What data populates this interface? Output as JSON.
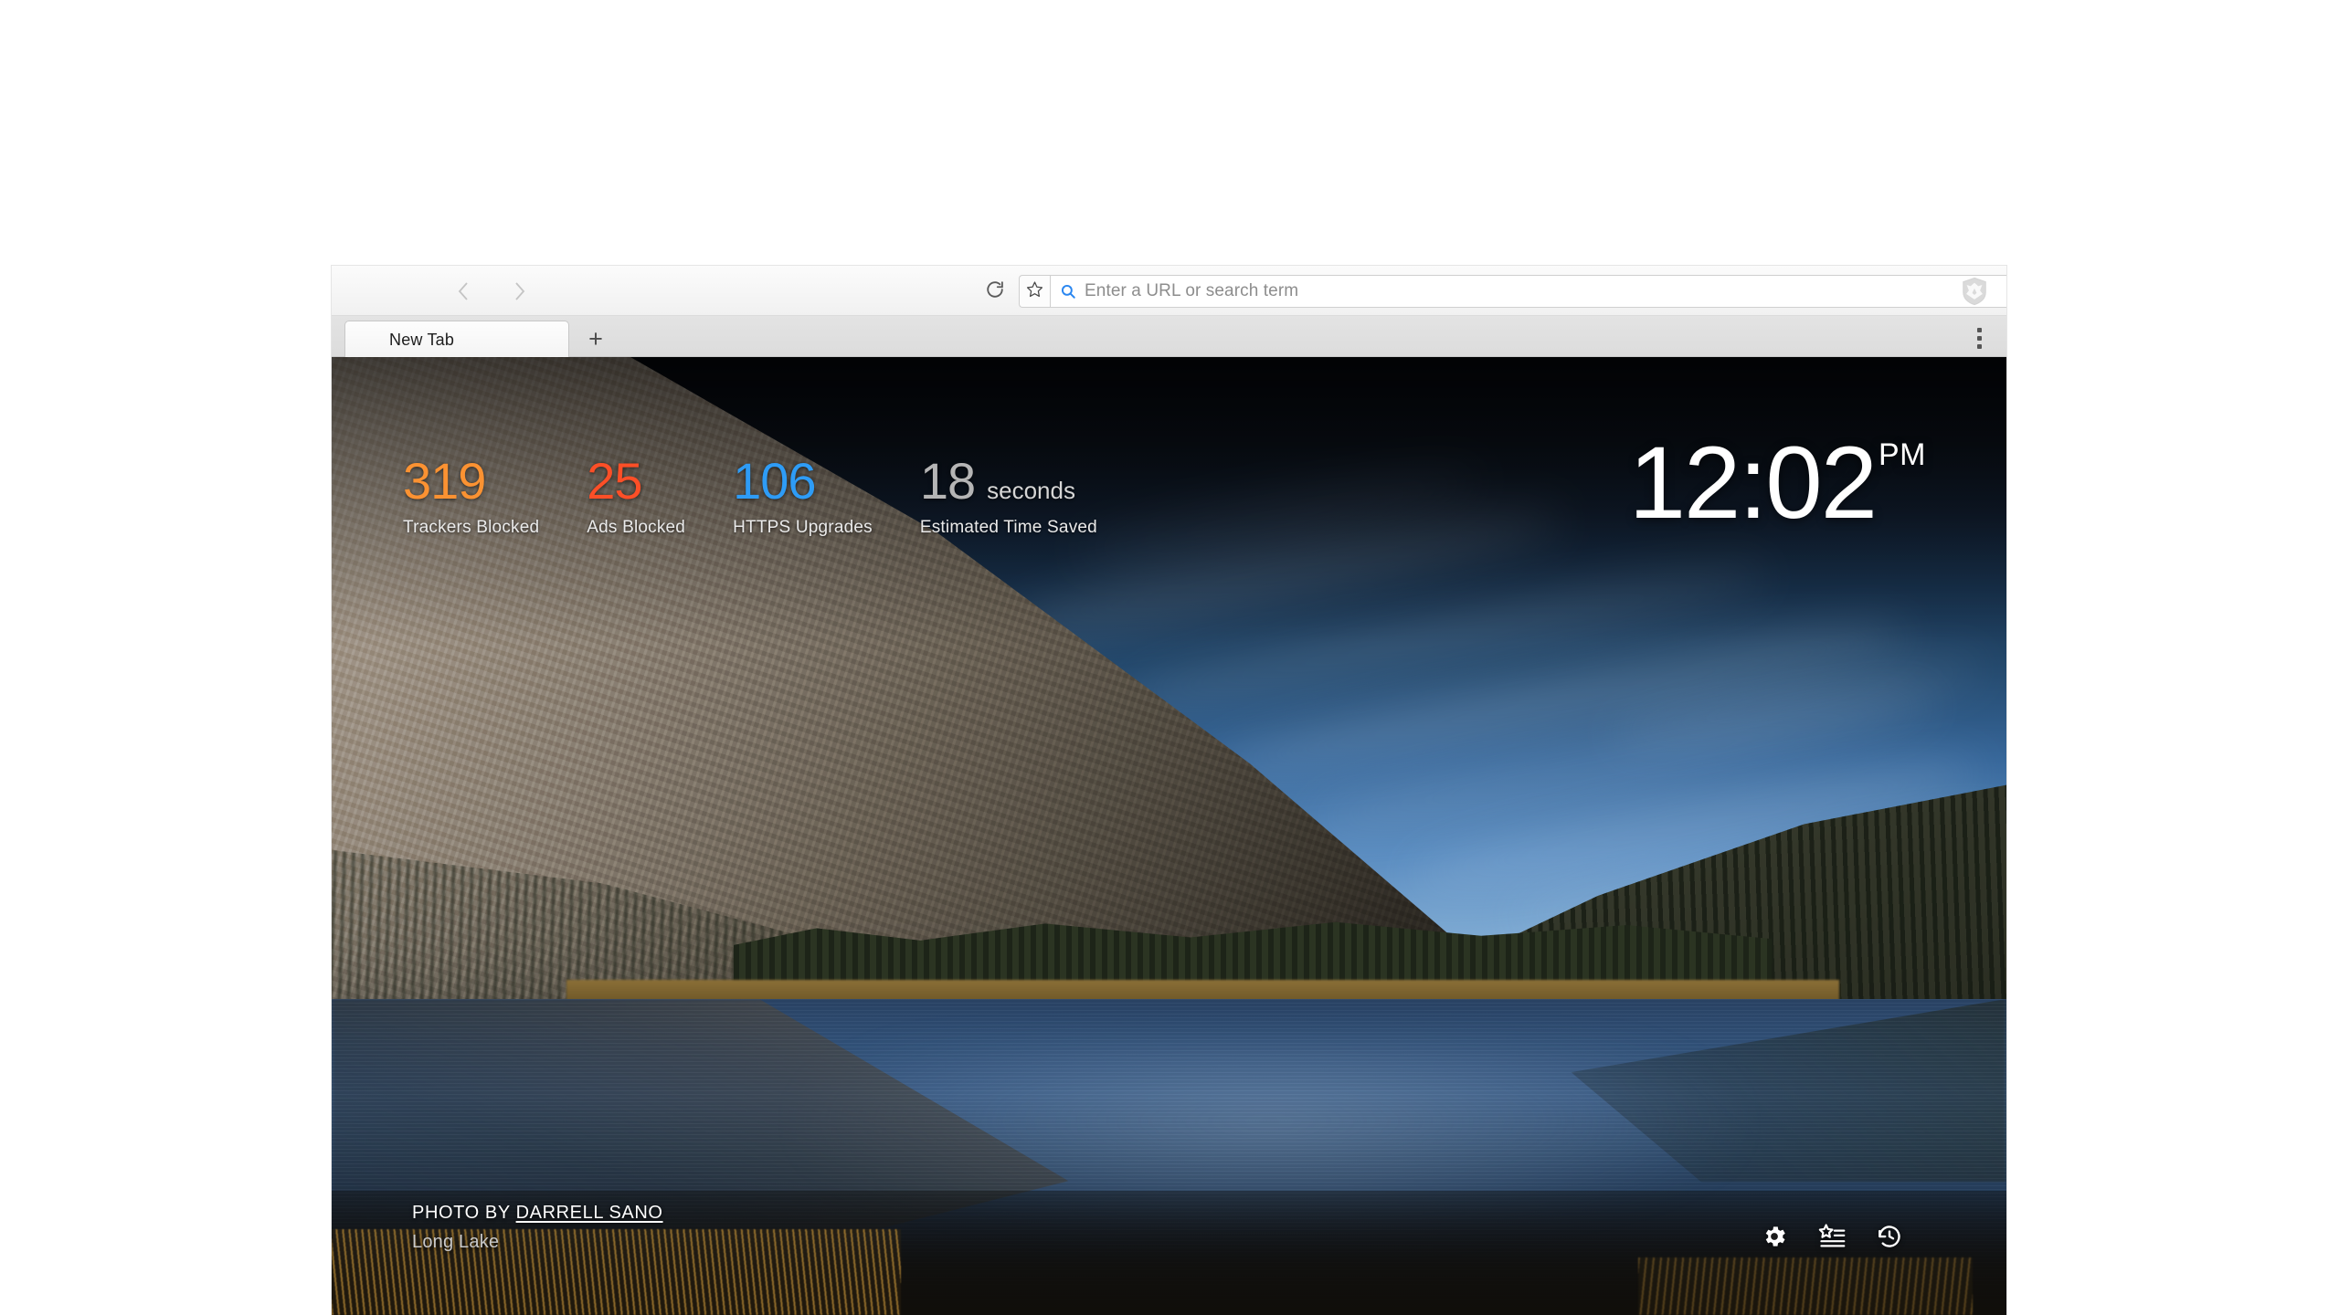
{
  "browser": {
    "toolbar": {
      "back_icon": "chevron-left-icon",
      "forward_icon": "chevron-right-icon",
      "reload_icon": "reload-icon",
      "bookmark_icon": "star-icon",
      "search_icon": "search-icon",
      "brave_icon": "brave-lion-shield-icon"
    },
    "urlbar": {
      "value": "",
      "placeholder": "Enter a URL or search term"
    },
    "tabstrip": {
      "tabs": [
        {
          "label": "New Tab",
          "active": true
        }
      ],
      "new_tab_button_label": "+",
      "menu_icon": "kebab-menu-icon"
    }
  },
  "newtab": {
    "stats": [
      {
        "value": "319",
        "unit": "",
        "label": "Trackers Blocked",
        "color": "#fb9232"
      },
      {
        "value": "25",
        "unit": "",
        "label": "Ads Blocked",
        "color": "#fc4f27"
      },
      {
        "value": "106",
        "unit": "",
        "label": "HTTPS Upgrades",
        "color": "#2e9cf6"
      },
      {
        "value": "18",
        "unit": "seconds",
        "label": "Estimated Time Saved",
        "color": "#b5b5b5"
      }
    ],
    "clock": {
      "time": "12:02",
      "meridiem": "PM"
    },
    "photo_credit": {
      "prefix": "PHOTO BY ",
      "author": "DARRELL SANO",
      "place": "Long Lake"
    },
    "actions": [
      {
        "name": "settings",
        "icon": "gear-icon"
      },
      {
        "name": "bookmarks",
        "icon": "star-list-icon"
      },
      {
        "name": "history",
        "icon": "history-clock-icon"
      }
    ]
  }
}
